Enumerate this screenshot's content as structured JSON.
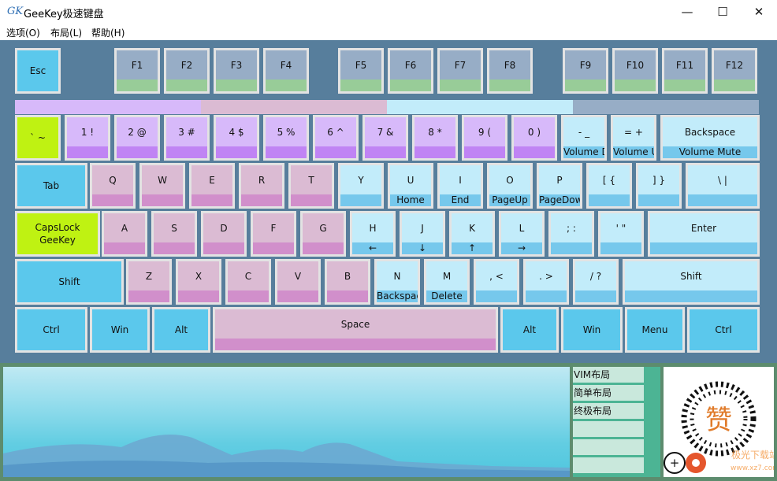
{
  "window": {
    "title": "GeeKey极速键盘",
    "app_icon": "GK",
    "minimize": "—",
    "maximize": "☐",
    "close": "✕"
  },
  "menu": [
    {
      "label": "选项(O)"
    },
    {
      "label": "布局(L)"
    },
    {
      "label": "帮助(H)"
    }
  ],
  "colors": {
    "keyboard_bg": "#577e9c",
    "key_blue": "#5bc8ec",
    "key_pink": "#dbbbd3",
    "pink_sub": "#d18fcb",
    "key_purple": "#d7b9fa",
    "purple_sub": "#c084f4",
    "key_light": "#c2ecfa",
    "light_sub": "#76c8ec",
    "key_lime": "#bff212",
    "fkey": "#97adc6",
    "fkey_sub": "#98cc98"
  },
  "keys": [
    {
      "n": "esc",
      "main": "Esc",
      "sub": "",
      "c": "blue"
    },
    {
      "n": "f1",
      "main": "F1",
      "sub": "",
      "c": "fkey"
    },
    {
      "n": "f2",
      "main": "F2",
      "sub": "",
      "c": "fkey"
    },
    {
      "n": "f3",
      "main": "F3",
      "sub": "",
      "c": "fkey"
    },
    {
      "n": "f4",
      "main": "F4",
      "sub": "",
      "c": "fkey"
    },
    {
      "n": "f5",
      "main": "F5",
      "sub": "",
      "c": "fkey"
    },
    {
      "n": "f6",
      "main": "F6",
      "sub": "",
      "c": "fkey"
    },
    {
      "n": "f7",
      "main": "F7",
      "sub": "",
      "c": "fkey"
    },
    {
      "n": "f8",
      "main": "F8",
      "sub": "",
      "c": "fkey"
    },
    {
      "n": "f9",
      "main": "F9",
      "sub": "",
      "c": "fkey"
    },
    {
      "n": "f10",
      "main": "F10",
      "sub": "",
      "c": "fkey"
    },
    {
      "n": "f11",
      "main": "F11",
      "sub": "",
      "c": "fkey"
    },
    {
      "n": "f12",
      "main": "F12",
      "sub": "",
      "c": "fkey"
    },
    {
      "n": "backtick",
      "main": "` ~",
      "sub": "",
      "c": "lime"
    },
    {
      "n": "1",
      "main": "1 !",
      "sub": "",
      "c": "purple"
    },
    {
      "n": "2",
      "main": "2 @",
      "sub": "",
      "c": "purple"
    },
    {
      "n": "3",
      "main": "3 #",
      "sub": "",
      "c": "purple"
    },
    {
      "n": "4",
      "main": "4 $",
      "sub": "",
      "c": "purple"
    },
    {
      "n": "5",
      "main": "5 %",
      "sub": "",
      "c": "purple"
    },
    {
      "n": "6",
      "main": "6 ^",
      "sub": "",
      "c": "purple"
    },
    {
      "n": "7",
      "main": "7 &",
      "sub": "",
      "c": "purple"
    },
    {
      "n": "8",
      "main": "8 *",
      "sub": "",
      "c": "purple"
    },
    {
      "n": "9",
      "main": "9 (",
      "sub": "",
      "c": "purple"
    },
    {
      "n": "0",
      "main": "0 )",
      "sub": "",
      "c": "purple"
    },
    {
      "n": "minus",
      "main": "- _",
      "sub": "Volume Down",
      "c": "light"
    },
    {
      "n": "equal",
      "main": "= +",
      "sub": "Volume Up",
      "c": "light"
    },
    {
      "n": "backspace",
      "main": "Backspace",
      "sub": "Volume Mute",
      "c": "light"
    },
    {
      "n": "tab",
      "main": "Tab",
      "sub": "",
      "c": "blue"
    },
    {
      "n": "q",
      "main": "Q",
      "sub": "",
      "c": "pink"
    },
    {
      "n": "w",
      "main": "W",
      "sub": "",
      "c": "pink"
    },
    {
      "n": "e",
      "main": "E",
      "sub": "",
      "c": "pink"
    },
    {
      "n": "r",
      "main": "R",
      "sub": "",
      "c": "pink"
    },
    {
      "n": "t",
      "main": "T",
      "sub": "",
      "c": "pink"
    },
    {
      "n": "y",
      "main": "Y",
      "sub": "",
      "c": "light"
    },
    {
      "n": "u",
      "main": "U",
      "sub": "Home",
      "c": "light"
    },
    {
      "n": "i",
      "main": "I",
      "sub": "End",
      "c": "light"
    },
    {
      "n": "o",
      "main": "O",
      "sub": "PageUp",
      "c": "light"
    },
    {
      "n": "p",
      "main": "P",
      "sub": "PageDown",
      "c": "light"
    },
    {
      "n": "lbracket",
      "main": "[ {",
      "sub": "",
      "c": "light"
    },
    {
      "n": "rbracket",
      "main": "] }",
      "sub": "",
      "c": "light"
    },
    {
      "n": "backslash",
      "main": "\\ |",
      "sub": "",
      "c": "light"
    },
    {
      "n": "capslock",
      "main": "CapsLock",
      "main2": "GeeKey",
      "sub": "",
      "c": "lime"
    },
    {
      "n": "a",
      "main": "A",
      "sub": "",
      "c": "pink"
    },
    {
      "n": "s",
      "main": "S",
      "sub": "",
      "c": "pink"
    },
    {
      "n": "d",
      "main": "D",
      "sub": "",
      "c": "pink"
    },
    {
      "n": "f",
      "main": "F",
      "sub": "",
      "c": "pink"
    },
    {
      "n": "g",
      "main": "G",
      "sub": "",
      "c": "pink"
    },
    {
      "n": "h",
      "main": "H",
      "sub": "←",
      "c": "light"
    },
    {
      "n": "j",
      "main": "J",
      "sub": "↓",
      "c": "light"
    },
    {
      "n": "k",
      "main": "K",
      "sub": "↑",
      "c": "light"
    },
    {
      "n": "l",
      "main": "L",
      "sub": "→",
      "c": "light"
    },
    {
      "n": "semicolon",
      "main": "; :",
      "sub": "",
      "c": "light"
    },
    {
      "n": "quote",
      "main": "' \"",
      "sub": "",
      "c": "light"
    },
    {
      "n": "enter",
      "main": "Enter",
      "sub": "",
      "c": "light"
    },
    {
      "n": "lshift",
      "main": "Shift",
      "sub": "",
      "c": "blue"
    },
    {
      "n": "z",
      "main": "Z",
      "sub": "",
      "c": "pink"
    },
    {
      "n": "x",
      "main": "X",
      "sub": "",
      "c": "pink"
    },
    {
      "n": "c",
      "main": "C",
      "sub": "",
      "c": "pink"
    },
    {
      "n": "v",
      "main": "V",
      "sub": "",
      "c": "pink"
    },
    {
      "n": "b",
      "main": "B",
      "sub": "",
      "c": "pink"
    },
    {
      "n": "n",
      "main": "N",
      "sub": "Backspace",
      "c": "light"
    },
    {
      "n": "m",
      "main": "M",
      "sub": "Delete",
      "c": "light"
    },
    {
      "n": "comma",
      "main": ", <",
      "sub": "",
      "c": "light"
    },
    {
      "n": "period",
      "main": ". >",
      "sub": "",
      "c": "light"
    },
    {
      "n": "slash",
      "main": "/ ?",
      "sub": "",
      "c": "light"
    },
    {
      "n": "rshift",
      "main": "Shift",
      "sub": "",
      "c": "light"
    },
    {
      "n": "lctrl",
      "main": "Ctrl",
      "sub": "",
      "c": "blue"
    },
    {
      "n": "lwin",
      "main": "Win",
      "sub": "",
      "c": "blue"
    },
    {
      "n": "lalt",
      "main": "Alt",
      "sub": "",
      "c": "blue"
    },
    {
      "n": "space",
      "main": "Space",
      "sub": "",
      "c": "pink"
    },
    {
      "n": "ralt",
      "main": "Alt",
      "sub": "",
      "c": "blue"
    },
    {
      "n": "rwin",
      "main": "Win",
      "sub": "",
      "c": "blue"
    },
    {
      "n": "menu",
      "main": "Menu",
      "sub": "",
      "c": "blue"
    },
    {
      "n": "rctrl",
      "main": "Ctrl",
      "sub": "",
      "c": "blue"
    }
  ],
  "layouts": [
    {
      "label": "VIM布局"
    },
    {
      "label": "简单布局"
    },
    {
      "label": "终极布局"
    },
    {
      "label": ""
    },
    {
      "label": ""
    },
    {
      "label": ""
    }
  ],
  "qr": {
    "center_char": "赞",
    "badge": "+",
    "watermark": "极光下载站",
    "watermark_url": "www.xz7.com"
  }
}
